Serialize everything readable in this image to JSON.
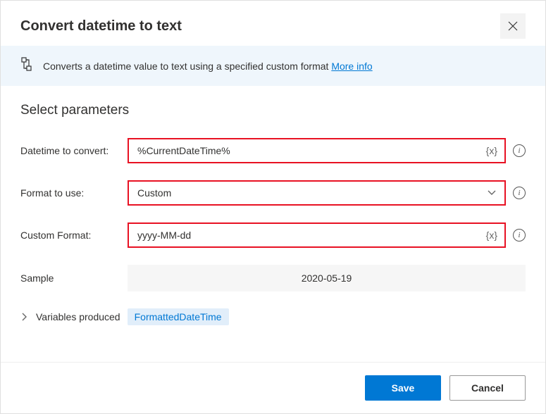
{
  "header": {
    "title": "Convert datetime to text"
  },
  "info": {
    "text": "Converts a datetime value to text using a specified custom format ",
    "link": "More info"
  },
  "section": {
    "title": "Select parameters"
  },
  "params": {
    "datetime": {
      "label": "Datetime to convert:",
      "value": "%CurrentDateTime%"
    },
    "format": {
      "label": "Format to use:",
      "value": "Custom"
    },
    "custom": {
      "label": "Custom Format:",
      "value": "yyyy-MM-dd"
    },
    "sample": {
      "label": "Sample",
      "value": "2020-05-19"
    }
  },
  "variables": {
    "label": "Variables produced",
    "badge": "FormattedDateTime"
  },
  "footer": {
    "save": "Save",
    "cancel": "Cancel"
  }
}
